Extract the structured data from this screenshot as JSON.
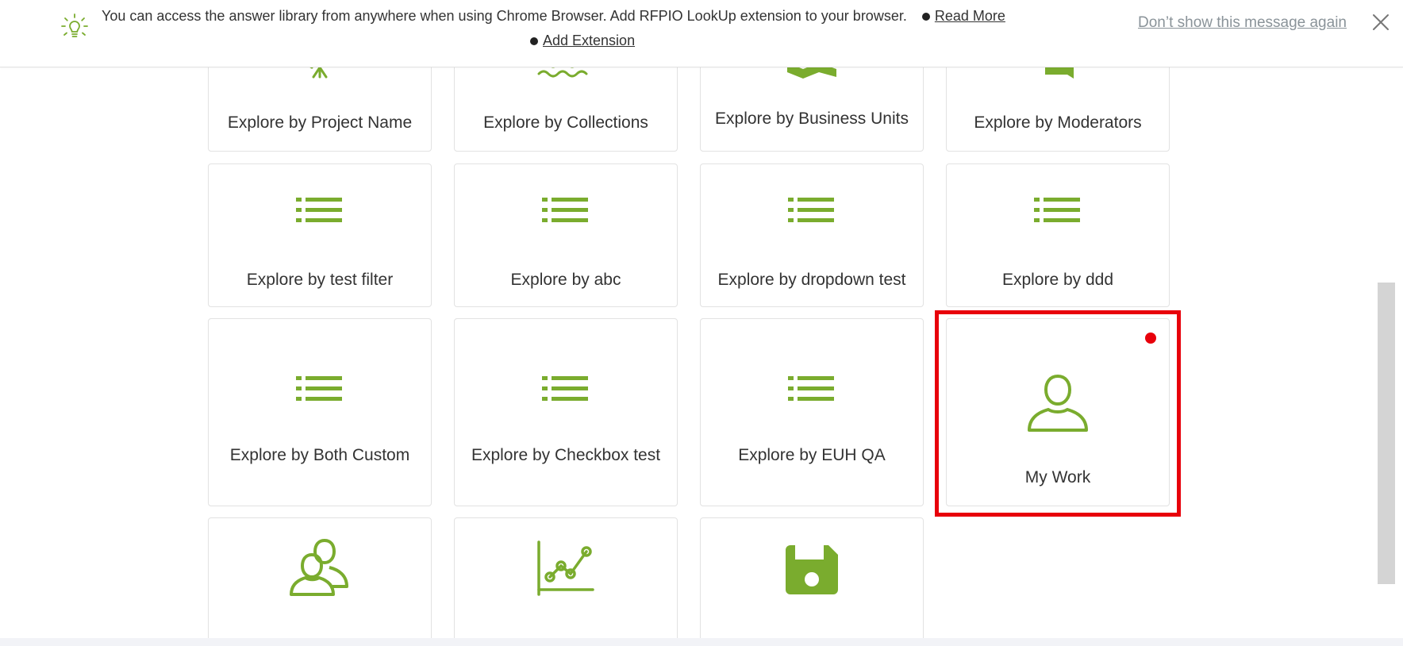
{
  "banner": {
    "message": "You can access the answer library from anywhere when using Chrome Browser. Add RFPIO LookUp extension to your browser.",
    "read_more": "Read More",
    "add_extension": "Add Extension",
    "dismiss": "Don’t show this message again"
  },
  "tiles": {
    "project_name": "Explore by Project Name",
    "collections": "Explore by Collections",
    "business_units": "Explore by Business Units",
    "moderators": "Explore by Moderators",
    "test_filter": "Explore by test filter",
    "abc": "Explore by abc",
    "dropdown_test": "Explore by dropdown test",
    "ddd": "Explore by ddd",
    "both_custom": "Explore by Both Custom",
    "checkbox_test": "Explore by Checkbox test",
    "euh_qa": "Explore by EUH QA",
    "my_work": "My Work"
  },
  "colors": {
    "accent": "#7aac2e",
    "highlight": "#e8000b",
    "text": "#333333",
    "muted_link": "#8a9399"
  }
}
